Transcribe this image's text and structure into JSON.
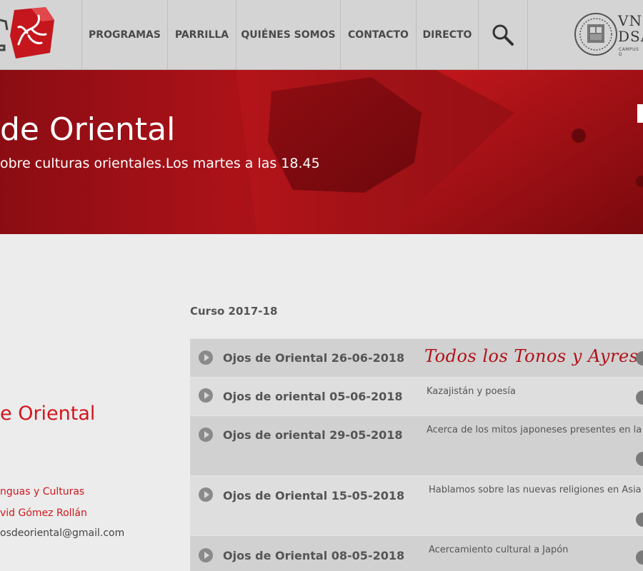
{
  "nav": {
    "items": [
      {
        "label": "PROGRAMAS"
      },
      {
        "label": "PARRILLA"
      },
      {
        "label": "QUIÉNES SOMOS"
      },
      {
        "label": "CONTACTO"
      },
      {
        "label": "DIRECTO"
      }
    ],
    "search_icon": "search-icon",
    "university_text_line1": "VNI",
    "university_text_line2": "DSA",
    "university_sub": "CAMPUS D"
  },
  "banner": {
    "title": "de Oriental",
    "subtitle": "obre culturas orientales.Los martes a las 18.45"
  },
  "sidebar": {
    "title": "e Oriental",
    "line1": "nguas y Culturas",
    "line2": "vid Gómez Rollán",
    "line3": "osdeoriental@gmail.com"
  },
  "section": {
    "title": "Curso 2017-18"
  },
  "episodes": [
    {
      "title": "Ojos de Oriental 26-06-2018",
      "desc": "Todos los Tonos y Ayres"
    },
    {
      "title": "Ojos de oriental 05-06-2018",
      "desc": "Kazajistán y poesía"
    },
    {
      "title": "Ojos de oriental 29-05-2018",
      "desc": "Acerca de los mitos japoneses presentes en la"
    },
    {
      "title": "Ojos de Oriental 15-05-2018",
      "desc": "Hablamos sobre las nuevas religiones en Asia"
    },
    {
      "title": "Ojos de Oriental 08-05-2018",
      "desc": "Acercamiento cultural a Japón"
    }
  ],
  "colors": {
    "accent_red": "#d2161c",
    "banner_red": "#9a0f14",
    "nav_bg": "#d4d4d4"
  }
}
